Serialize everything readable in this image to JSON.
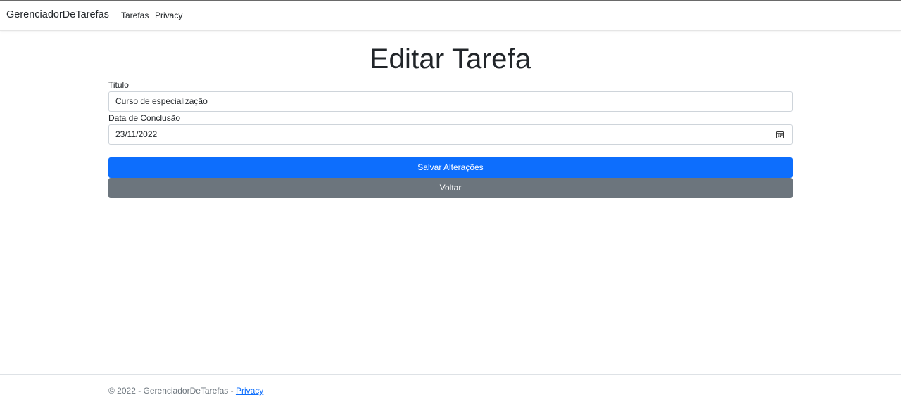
{
  "navbar": {
    "brand": "GerenciadorDeTarefas",
    "links": [
      "Tarefas",
      "Privacy"
    ]
  },
  "page": {
    "title": "Editar Tarefa"
  },
  "form": {
    "titulo_label": "Titulo",
    "titulo_value": "Curso de especialização",
    "data_label": "Data de Conclusão",
    "data_value": "23/11/2022",
    "save_label": "Salvar Alterações",
    "back_label": "Voltar"
  },
  "footer": {
    "text": "© 2022 - GerenciadorDeTarefas - ",
    "privacy_link": "Privacy"
  },
  "icons": {
    "date_picker": "calendar-icon"
  },
  "colors": {
    "primary": "#0d6efd",
    "secondary": "#6c757d"
  }
}
